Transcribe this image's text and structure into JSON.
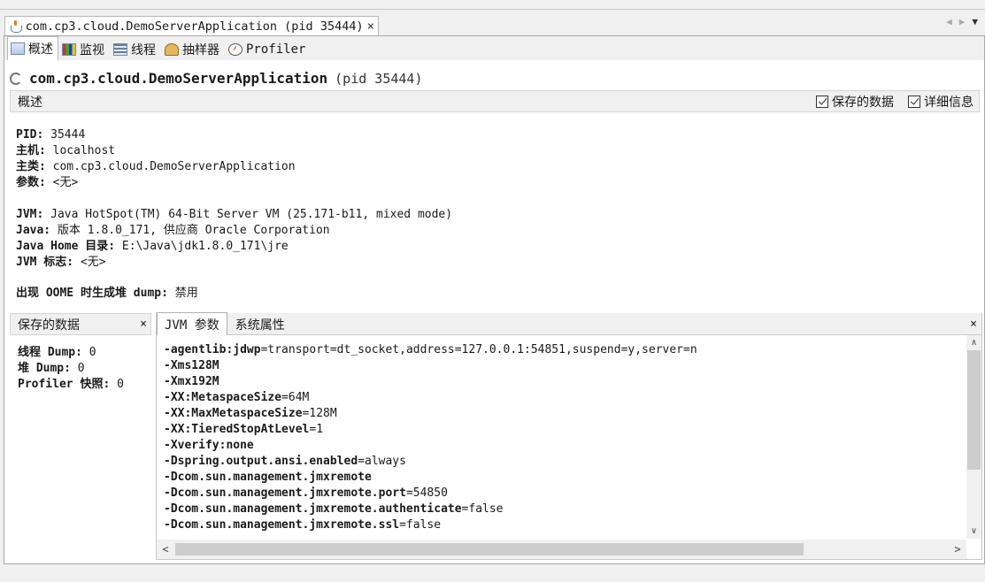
{
  "document_tab": {
    "title": "com.cp3.cloud.DemoServerApplication (pid 35444)",
    "close": "×"
  },
  "nav": {
    "prev": "◀",
    "next": "▶",
    "menu": "▼"
  },
  "view_tabs": [
    {
      "label": "概述",
      "icon": "overview-icon"
    },
    {
      "label": "监视",
      "icon": "monitor-icon"
    },
    {
      "label": "线程",
      "icon": "threads-icon"
    },
    {
      "label": "抽样器",
      "icon": "sampler-icon"
    },
    {
      "label": "Profiler",
      "icon": "profiler-icon"
    }
  ],
  "header": {
    "app_name": "com.cp3.cloud.DemoServerApplication",
    "pid_text": "(pid 35444)"
  },
  "overview_bar": {
    "title": "概述",
    "saved_data_label": "保存的数据",
    "details_label": "详细信息"
  },
  "process_info": {
    "pid_label": "PID:",
    "pid_value": "35444",
    "host_label": "主机:",
    "host_value": "localhost",
    "main_class_label": "主类:",
    "main_class_value": "com.cp3.cloud.DemoServerApplication",
    "args_label": "参数:",
    "args_value": "<无>"
  },
  "jvm_info": {
    "jvm_label": "JVM:",
    "jvm_value": "Java HotSpot(TM) 64-Bit Server VM (25.171-b11, mixed mode)",
    "java_label": "Java:",
    "java_value": "版本 1.8.0_171, 供应商 Oracle Corporation",
    "java_home_label": "Java Home 目录:",
    "java_home_value": "E:\\Java\\jdk1.8.0_171\\jre",
    "jvm_flags_label": "JVM 标志:",
    "jvm_flags_value": "<无>"
  },
  "oome": {
    "label": "出现 OOME 时生成堆 dump:",
    "value": "禁用"
  },
  "saved_data_pane": {
    "title": "保存的数据",
    "close": "×",
    "thread_dump_label": "线程 Dump:",
    "thread_dump_value": "0",
    "heap_dump_label": "堆 Dump:",
    "heap_dump_value": "0",
    "profiler_snapshot_label": "Profiler 快照:",
    "profiler_snapshot_value": "0"
  },
  "right_pane": {
    "tabs": [
      "JVM 参数",
      "系统属性"
    ],
    "close": "×",
    "jvm_args": [
      {
        "key": "-agentlib:jdwp",
        "value": "=transport=dt_socket,address=127.0.0.1:54851,suspend=y,server=n"
      },
      {
        "key": "-Xms128M",
        "value": ""
      },
      {
        "key": "-Xmx192M",
        "value": ""
      },
      {
        "key": "-XX:MetaspaceSize",
        "value": "=64M"
      },
      {
        "key": "-XX:MaxMetaspaceSize",
        "value": "=128M"
      },
      {
        "key": "-XX:TieredStopAtLevel",
        "value": "=1"
      },
      {
        "key": "-Xverify:none",
        "value": ""
      },
      {
        "key": "-Dspring.output.ansi.enabled",
        "value": "=always"
      },
      {
        "key": "-Dcom.sun.management.jmxremote",
        "value": ""
      },
      {
        "key": "-Dcom.sun.management.jmxremote.port",
        "value": "=54850"
      },
      {
        "key": "-Dcom.sun.management.jmxremote.authenticate",
        "value": "=false"
      },
      {
        "key": "-Dcom.sun.management.jmxremote.ssl",
        "value": "=false"
      }
    ]
  },
  "scroll": {
    "up": "∧",
    "down": "∨",
    "left": "<",
    "right": ">"
  }
}
